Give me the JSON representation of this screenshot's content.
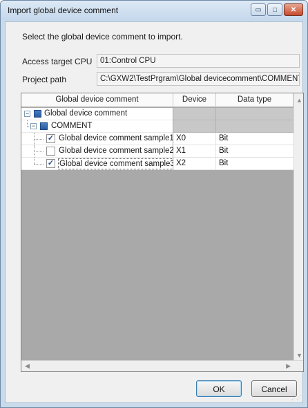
{
  "window": {
    "title": "Import global device comment",
    "minimize_glyph": "▭",
    "maximize_glyph": "□",
    "close_glyph": "✕"
  },
  "instruction": "Select the global device comment to import.",
  "access_target": {
    "label": "Access target CPU",
    "value": "01:Control CPU"
  },
  "project_path": {
    "label": "Project path",
    "value": "C:\\GXW2\\TestPrgram\\Global devicecomment\\COMMENT"
  },
  "grid": {
    "columns": [
      "Global device comment",
      "Device",
      "Data type"
    ],
    "root": {
      "label": "Global device comment",
      "expander": "−"
    },
    "group": {
      "label": "COMMENT",
      "expander": "−"
    },
    "rows": [
      {
        "label": "Global device comment sample1",
        "checked": true,
        "device": "X0",
        "data_type": "Bit"
      },
      {
        "label": "Global device comment sample2",
        "checked": false,
        "device": "X1",
        "data_type": "Bit"
      },
      {
        "label": "Global device comment sample3",
        "checked": true,
        "device": "X2",
        "data_type": "Bit"
      }
    ],
    "checkmark": "✓"
  },
  "buttons": {
    "ok": "OK",
    "cancel": "Cancel"
  },
  "colors": {
    "titlebar": "#c5d8ec",
    "grid_bg": "#a9a9a9",
    "close": "#c64a2e"
  },
  "icons": [
    "minimize-icon",
    "maximize-icon",
    "close-icon",
    "expander-icon",
    "node-icon",
    "checkbox-icon",
    "scroll-arrow-icon",
    "resize-grip-icon"
  ]
}
